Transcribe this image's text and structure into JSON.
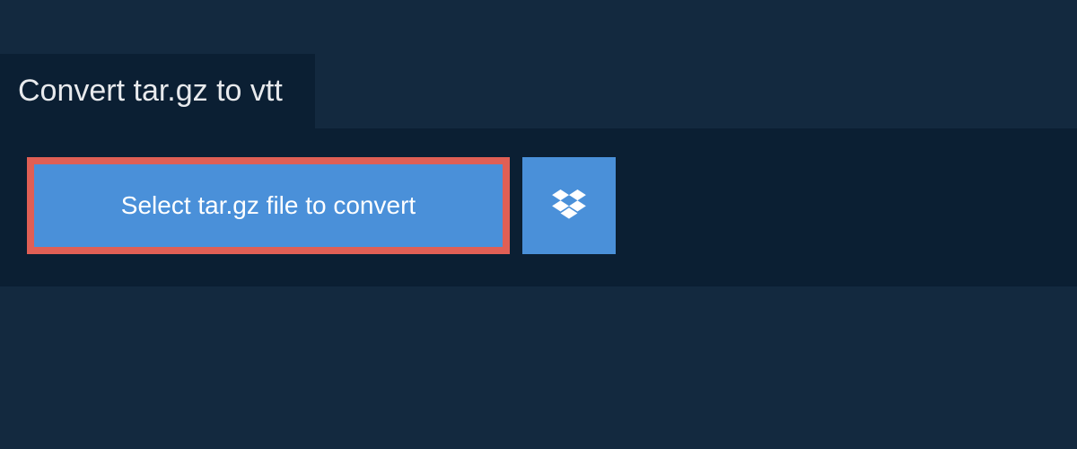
{
  "header": {
    "title": "Convert tar.gz to vtt"
  },
  "actions": {
    "select_file_label": "Select tar.gz file to convert"
  },
  "icons": {
    "dropbox": "dropbox-icon"
  },
  "colors": {
    "page_bg": "#13293f",
    "panel_bg": "#0b1f33",
    "button_bg": "#4a90d9",
    "highlight_border": "#e05f55",
    "text": "#e8eaed"
  }
}
